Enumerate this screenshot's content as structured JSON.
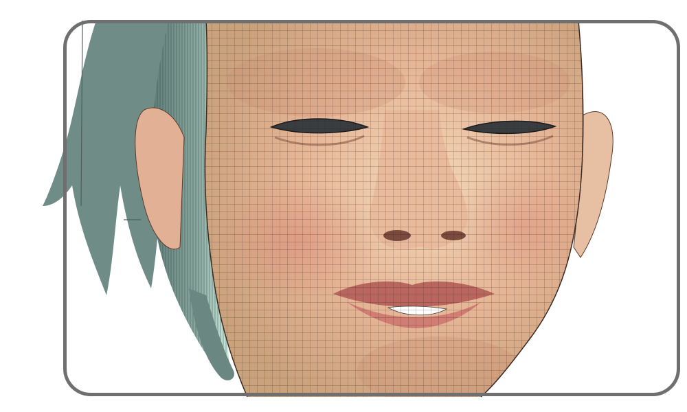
{
  "scene": {
    "subject": "3d-head-wireframe-render",
    "colors": {
      "background": "#ffffff",
      "frame_border": "#6f6f6f",
      "skin_light": "#f0d2b0",
      "skin_mid": "#dea88a",
      "skin_shadow": "#b87a62",
      "lip": "#c9756c",
      "teeth": "#ffffff",
      "hair_dark": "#6e8a84",
      "hair_light": "#bfe6d9",
      "wire": "#1a1a1a"
    },
    "icons": {
      "frame": "rounded-rect-frame",
      "hair": "hair-strands",
      "face": "face-mesh"
    }
  }
}
